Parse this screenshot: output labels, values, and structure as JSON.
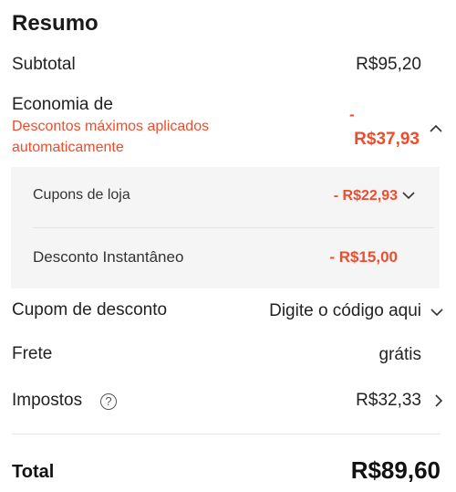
{
  "summary": {
    "title": "Resumo",
    "subtotal": {
      "label": "Subtotal",
      "value": "R$95,20"
    },
    "savings": {
      "label": "Economia de",
      "note_line1": "Descontos máximos aplicados",
      "note_line2": "automaticamente",
      "value_dash": "-",
      "value": "R$37,93",
      "items": [
        {
          "label": "Cupons de loja",
          "value": "- R$22,93"
        },
        {
          "label": "Desconto Instantâneo",
          "value": "- R$15,00"
        }
      ]
    },
    "coupon": {
      "label": "Cupom de desconto",
      "placeholder": "Digite o código aqui"
    },
    "shipping": {
      "label": "Frete",
      "value": "grátis"
    },
    "taxes": {
      "label": "Impostos",
      "help_glyph": "?",
      "value": "R$32,33"
    },
    "total": {
      "label": "Total",
      "value": "R$89,60"
    }
  },
  "colors": {
    "accent": "#ee4d2d",
    "panel_bg": "#f5f5f5",
    "text": "#222222"
  },
  "icons": [
    "chevron-up-icon",
    "chevron-down-icon",
    "chevron-right-icon",
    "help-circle-icon"
  ]
}
